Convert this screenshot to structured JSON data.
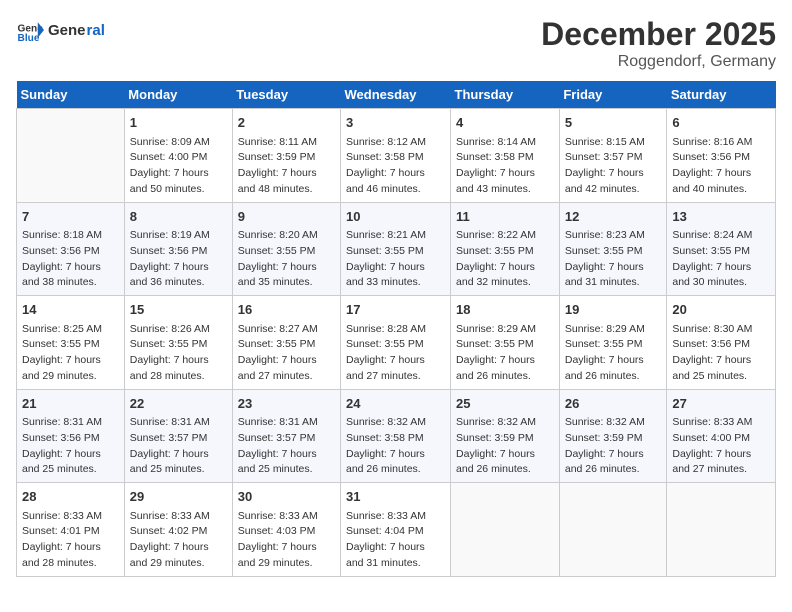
{
  "header": {
    "logo_general": "General",
    "logo_blue": "Blue",
    "title": "December 2025",
    "subtitle": "Roggendorf, Germany"
  },
  "columns": [
    "Sunday",
    "Monday",
    "Tuesday",
    "Wednesday",
    "Thursday",
    "Friday",
    "Saturday"
  ],
  "weeks": [
    [
      {
        "day": "",
        "sunrise": "",
        "sunset": "",
        "daylight": ""
      },
      {
        "day": "1",
        "sunrise": "Sunrise: 8:09 AM",
        "sunset": "Sunset: 4:00 PM",
        "daylight": "Daylight: 7 hours and 50 minutes."
      },
      {
        "day": "2",
        "sunrise": "Sunrise: 8:11 AM",
        "sunset": "Sunset: 3:59 PM",
        "daylight": "Daylight: 7 hours and 48 minutes."
      },
      {
        "day": "3",
        "sunrise": "Sunrise: 8:12 AM",
        "sunset": "Sunset: 3:58 PM",
        "daylight": "Daylight: 7 hours and 46 minutes."
      },
      {
        "day": "4",
        "sunrise": "Sunrise: 8:14 AM",
        "sunset": "Sunset: 3:58 PM",
        "daylight": "Daylight: 7 hours and 43 minutes."
      },
      {
        "day": "5",
        "sunrise": "Sunrise: 8:15 AM",
        "sunset": "Sunset: 3:57 PM",
        "daylight": "Daylight: 7 hours and 42 minutes."
      },
      {
        "day": "6",
        "sunrise": "Sunrise: 8:16 AM",
        "sunset": "Sunset: 3:56 PM",
        "daylight": "Daylight: 7 hours and 40 minutes."
      }
    ],
    [
      {
        "day": "7",
        "sunrise": "Sunrise: 8:18 AM",
        "sunset": "Sunset: 3:56 PM",
        "daylight": "Daylight: 7 hours and 38 minutes."
      },
      {
        "day": "8",
        "sunrise": "Sunrise: 8:19 AM",
        "sunset": "Sunset: 3:56 PM",
        "daylight": "Daylight: 7 hours and 36 minutes."
      },
      {
        "day": "9",
        "sunrise": "Sunrise: 8:20 AM",
        "sunset": "Sunset: 3:55 PM",
        "daylight": "Daylight: 7 hours and 35 minutes."
      },
      {
        "day": "10",
        "sunrise": "Sunrise: 8:21 AM",
        "sunset": "Sunset: 3:55 PM",
        "daylight": "Daylight: 7 hours and 33 minutes."
      },
      {
        "day": "11",
        "sunrise": "Sunrise: 8:22 AM",
        "sunset": "Sunset: 3:55 PM",
        "daylight": "Daylight: 7 hours and 32 minutes."
      },
      {
        "day": "12",
        "sunrise": "Sunrise: 8:23 AM",
        "sunset": "Sunset: 3:55 PM",
        "daylight": "Daylight: 7 hours and 31 minutes."
      },
      {
        "day": "13",
        "sunrise": "Sunrise: 8:24 AM",
        "sunset": "Sunset: 3:55 PM",
        "daylight": "Daylight: 7 hours and 30 minutes."
      }
    ],
    [
      {
        "day": "14",
        "sunrise": "Sunrise: 8:25 AM",
        "sunset": "Sunset: 3:55 PM",
        "daylight": "Daylight: 7 hours and 29 minutes."
      },
      {
        "day": "15",
        "sunrise": "Sunrise: 8:26 AM",
        "sunset": "Sunset: 3:55 PM",
        "daylight": "Daylight: 7 hours and 28 minutes."
      },
      {
        "day": "16",
        "sunrise": "Sunrise: 8:27 AM",
        "sunset": "Sunset: 3:55 PM",
        "daylight": "Daylight: 7 hours and 27 minutes."
      },
      {
        "day": "17",
        "sunrise": "Sunrise: 8:28 AM",
        "sunset": "Sunset: 3:55 PM",
        "daylight": "Daylight: 7 hours and 27 minutes."
      },
      {
        "day": "18",
        "sunrise": "Sunrise: 8:29 AM",
        "sunset": "Sunset: 3:55 PM",
        "daylight": "Daylight: 7 hours and 26 minutes."
      },
      {
        "day": "19",
        "sunrise": "Sunrise: 8:29 AM",
        "sunset": "Sunset: 3:55 PM",
        "daylight": "Daylight: 7 hours and 26 minutes."
      },
      {
        "day": "20",
        "sunrise": "Sunrise: 8:30 AM",
        "sunset": "Sunset: 3:56 PM",
        "daylight": "Daylight: 7 hours and 25 minutes."
      }
    ],
    [
      {
        "day": "21",
        "sunrise": "Sunrise: 8:31 AM",
        "sunset": "Sunset: 3:56 PM",
        "daylight": "Daylight: 7 hours and 25 minutes."
      },
      {
        "day": "22",
        "sunrise": "Sunrise: 8:31 AM",
        "sunset": "Sunset: 3:57 PM",
        "daylight": "Daylight: 7 hours and 25 minutes."
      },
      {
        "day": "23",
        "sunrise": "Sunrise: 8:31 AM",
        "sunset": "Sunset: 3:57 PM",
        "daylight": "Daylight: 7 hours and 25 minutes."
      },
      {
        "day": "24",
        "sunrise": "Sunrise: 8:32 AM",
        "sunset": "Sunset: 3:58 PM",
        "daylight": "Daylight: 7 hours and 26 minutes."
      },
      {
        "day": "25",
        "sunrise": "Sunrise: 8:32 AM",
        "sunset": "Sunset: 3:59 PM",
        "daylight": "Daylight: 7 hours and 26 minutes."
      },
      {
        "day": "26",
        "sunrise": "Sunrise: 8:32 AM",
        "sunset": "Sunset: 3:59 PM",
        "daylight": "Daylight: 7 hours and 26 minutes."
      },
      {
        "day": "27",
        "sunrise": "Sunrise: 8:33 AM",
        "sunset": "Sunset: 4:00 PM",
        "daylight": "Daylight: 7 hours and 27 minutes."
      }
    ],
    [
      {
        "day": "28",
        "sunrise": "Sunrise: 8:33 AM",
        "sunset": "Sunset: 4:01 PM",
        "daylight": "Daylight: 7 hours and 28 minutes."
      },
      {
        "day": "29",
        "sunrise": "Sunrise: 8:33 AM",
        "sunset": "Sunset: 4:02 PM",
        "daylight": "Daylight: 7 hours and 29 minutes."
      },
      {
        "day": "30",
        "sunrise": "Sunrise: 8:33 AM",
        "sunset": "Sunset: 4:03 PM",
        "daylight": "Daylight: 7 hours and 29 minutes."
      },
      {
        "day": "31",
        "sunrise": "Sunrise: 8:33 AM",
        "sunset": "Sunset: 4:04 PM",
        "daylight": "Daylight: 7 hours and 31 minutes."
      },
      {
        "day": "",
        "sunrise": "",
        "sunset": "",
        "daylight": ""
      },
      {
        "day": "",
        "sunrise": "",
        "sunset": "",
        "daylight": ""
      },
      {
        "day": "",
        "sunrise": "",
        "sunset": "",
        "daylight": ""
      }
    ]
  ]
}
